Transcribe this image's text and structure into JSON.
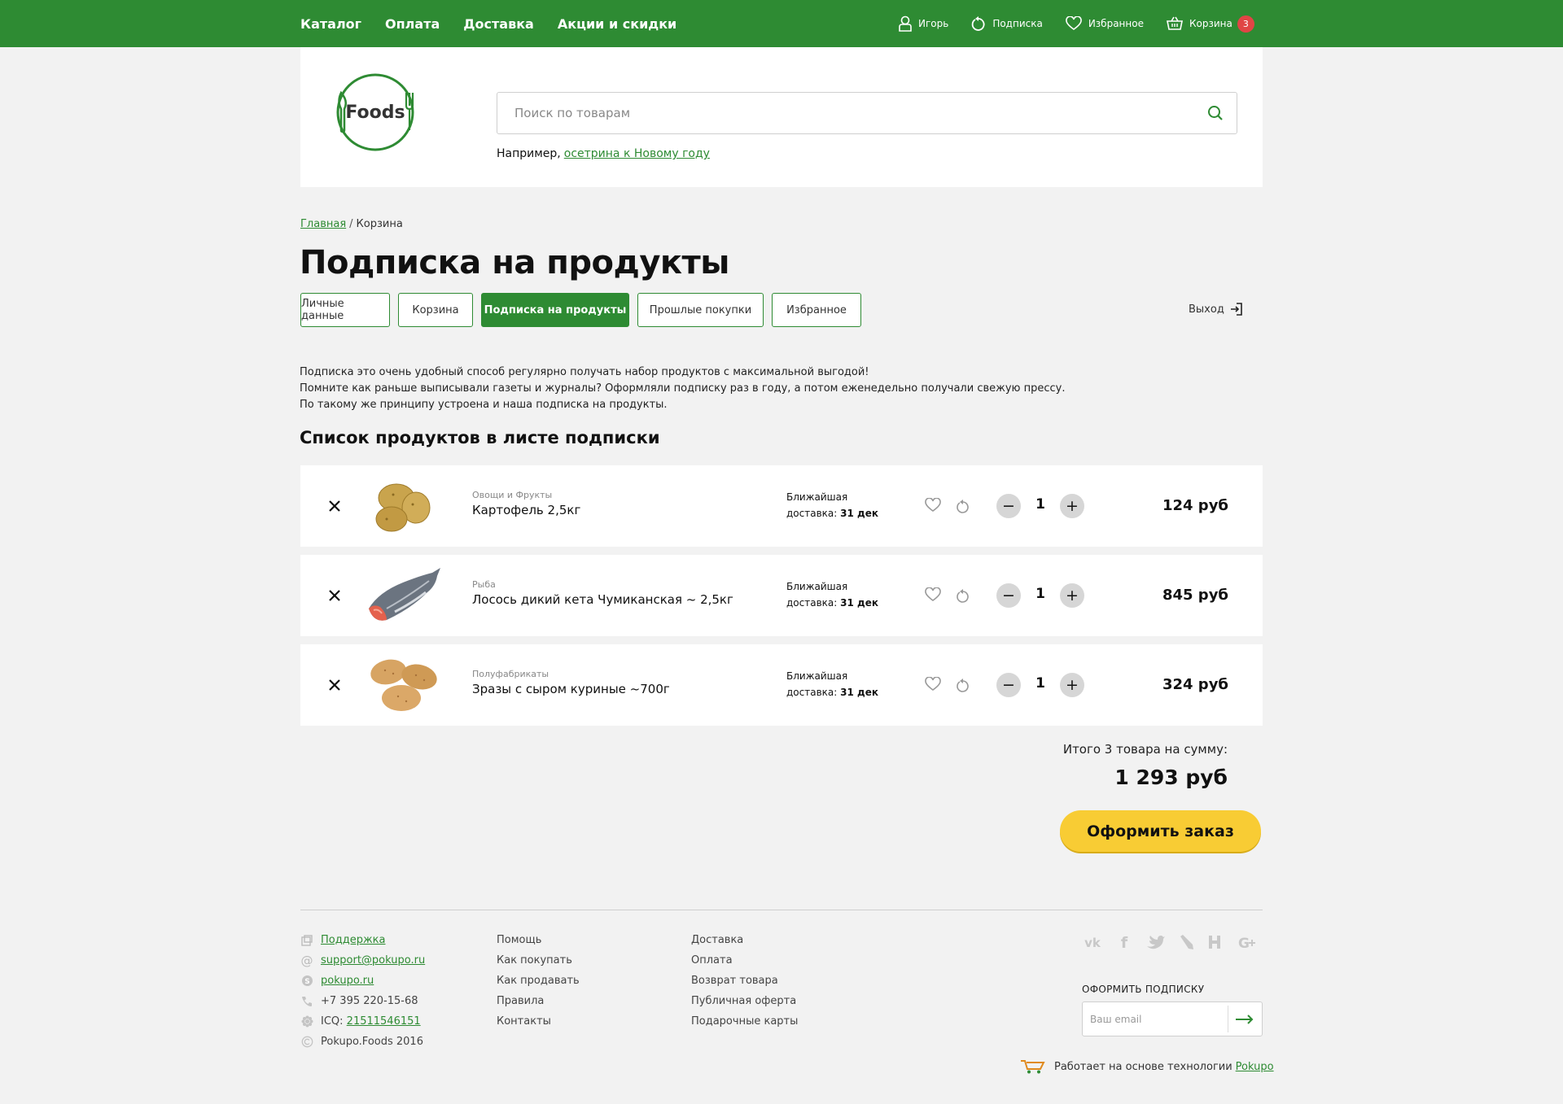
{
  "topnav": [
    "Каталог",
    "Оплата",
    "Доставка",
    "Акции и скидки"
  ],
  "topright": {
    "user": "Игорь",
    "subscription": "Подписка",
    "favorites": "Избранное",
    "cart": "Корзина",
    "cart_count": "3"
  },
  "header": {
    "logo_text": "Foods",
    "search_placeholder": "Поиск по товарам",
    "example_prefix": "Например,",
    "example_link": "осетрина к Новому году"
  },
  "breadcrumb": {
    "home": "Главная",
    "separator": "/",
    "current": "Корзина"
  },
  "page_title": "Подписка на продукты",
  "tabs": [
    {
      "label": "Личные данные",
      "active": false
    },
    {
      "label": "Корзина",
      "active": false
    },
    {
      "label": "Подписка на продукты",
      "active": true
    },
    {
      "label": "Прошлые покупки",
      "active": false
    },
    {
      "label": "Избранное",
      "active": false
    }
  ],
  "logout": "Выход",
  "intro": [
    "Подписка это очень удобный способ регулярно получать набор продуктов с максимальной выгодой!",
    "Помните как раньше выписывали газеты и журналы? Оформляли подписку раз в году, а потом еженедельно получали свежую прессу.",
    "По такому же принципу устроена и наша подписка на продукты."
  ],
  "list_title": "Список продуктов в листе подписки",
  "delivery_label_1": "Ближайшая",
  "delivery_label_2": "доставка:",
  "items": [
    {
      "category": "Овощи и Фрукты",
      "name": "Картофель 2,5кг",
      "delivery_date": "31 дек",
      "qty": "1",
      "price": "124 руб",
      "image": "potatoes"
    },
    {
      "category": "Рыба",
      "name": "Лосось дикий кета Чумиканская ~ 2,5кг",
      "delivery_date": "31 дек",
      "qty": "1",
      "price": "845 руб",
      "image": "salmon"
    },
    {
      "category": "Полуфабрикаты",
      "name": "Зразы с сыром куриные ~700г",
      "delivery_date": "31 дек",
      "qty": "1",
      "price": "324 руб",
      "image": "zrazy"
    }
  ],
  "total_label": "Итого 3 товара на сумму:",
  "total_sum": "1 293 руб",
  "order_button": "Оформить заказ",
  "footer": {
    "contacts": [
      {
        "icon": "support-icon",
        "text": "Поддержка",
        "link": true
      },
      {
        "icon": "at-icon",
        "text": "support@pokupo.ru",
        "link": true
      },
      {
        "icon": "skype-icon",
        "text": "pokupo.ru",
        "link": true
      },
      {
        "icon": "phone-icon",
        "text": "+7 395 220-15-68",
        "link": false
      },
      {
        "icon": "icq-icon",
        "prefix": "ICQ:",
        "text": "21511546151",
        "link": true
      },
      {
        "icon": "copyright-icon",
        "text": "Pokupo.Foods 2016",
        "link": false
      }
    ],
    "col2": [
      "Помощь",
      "Как покупать",
      "Как продавать",
      "Правила",
      "Контакты"
    ],
    "col3": [
      "Доставка",
      "Оплата",
      "Возврат товара",
      "Публичная оферта",
      "Подарочные карты"
    ],
    "social": [
      "vk-icon",
      "facebook-icon",
      "twitter-icon",
      "livejournal-icon",
      "habr-icon",
      "google-plus-icon"
    ],
    "subscribe_title": "ОФОРМИТЬ ПОДПИСКУ",
    "email_placeholder": "Ваш email",
    "powered_text": "Работает на основе технологии",
    "powered_link": "Pokupo"
  },
  "colors": {
    "brand_green": "#2e8b33",
    "accent_yellow": "#f8cc34",
    "badge_red": "#e04545",
    "background": "#f2f2f2"
  }
}
